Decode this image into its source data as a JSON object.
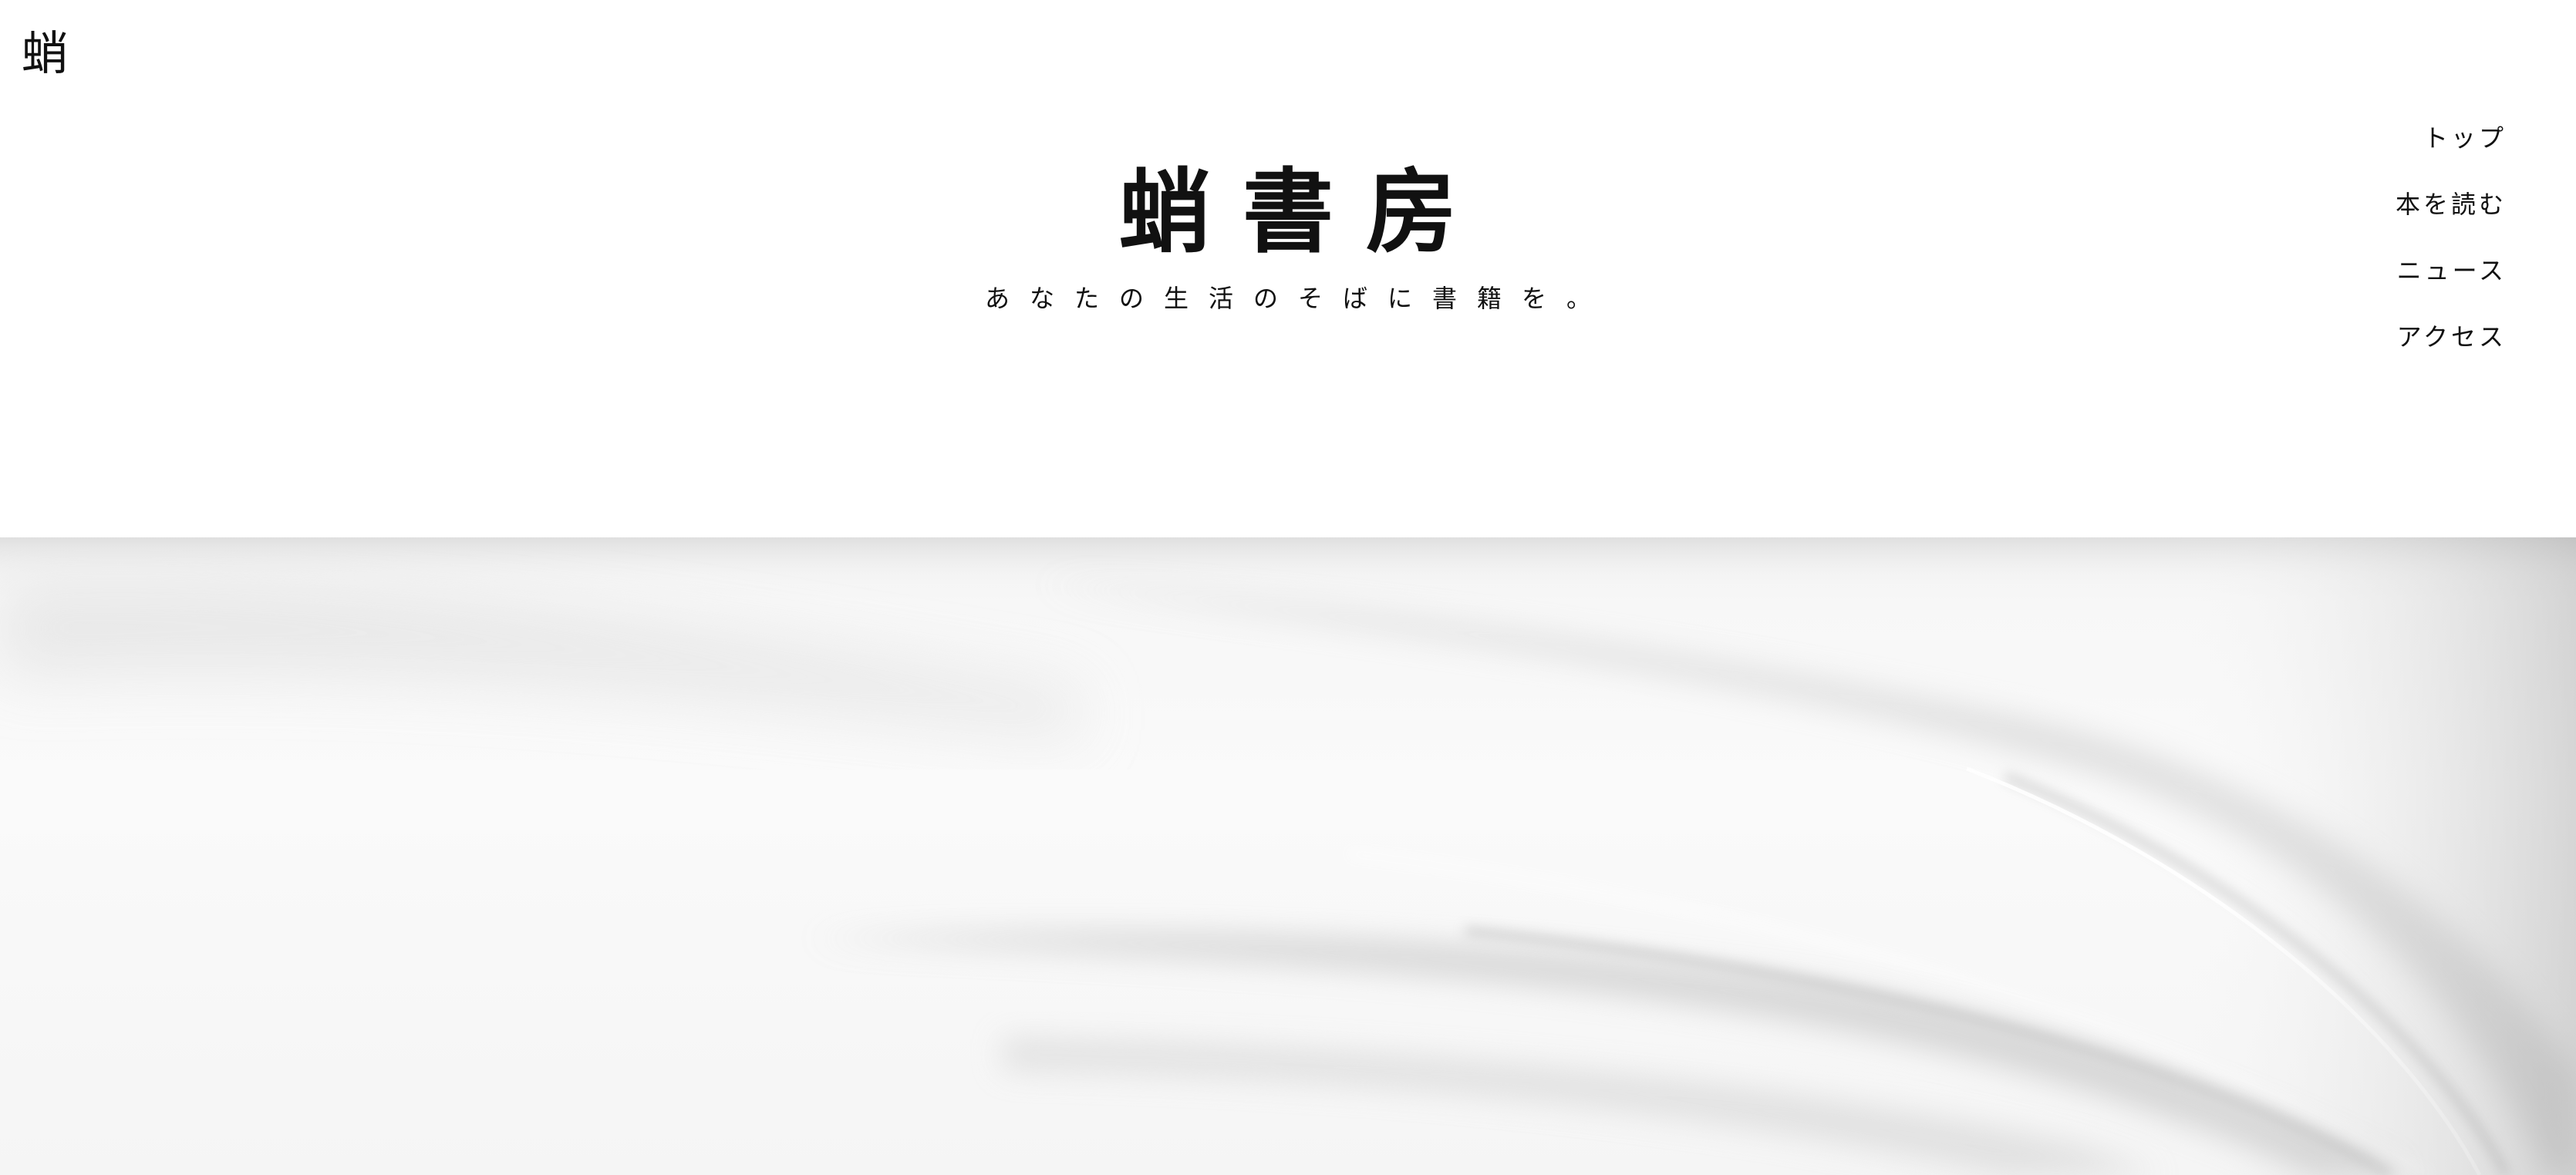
{
  "brand": {
    "logo_mark": "蛸"
  },
  "hero_heading": {
    "title": "蛸書房",
    "tagline": "あなたの生活のそばに書籍を。"
  },
  "nav": {
    "items": [
      {
        "label": "トップ",
        "name": "nav-item-top"
      },
      {
        "label": "本を読む",
        "name": "nav-item-read"
      },
      {
        "label": "ニュース",
        "name": "nav-item-news"
      },
      {
        "label": "アクセス",
        "name": "nav-item-access"
      }
    ]
  },
  "hero_image": {
    "subject": "open-book-pages-photo",
    "palette": [
      "#ffffff",
      "#f4f4f4",
      "#d9d9d9",
      "#9a9a9a"
    ]
  }
}
